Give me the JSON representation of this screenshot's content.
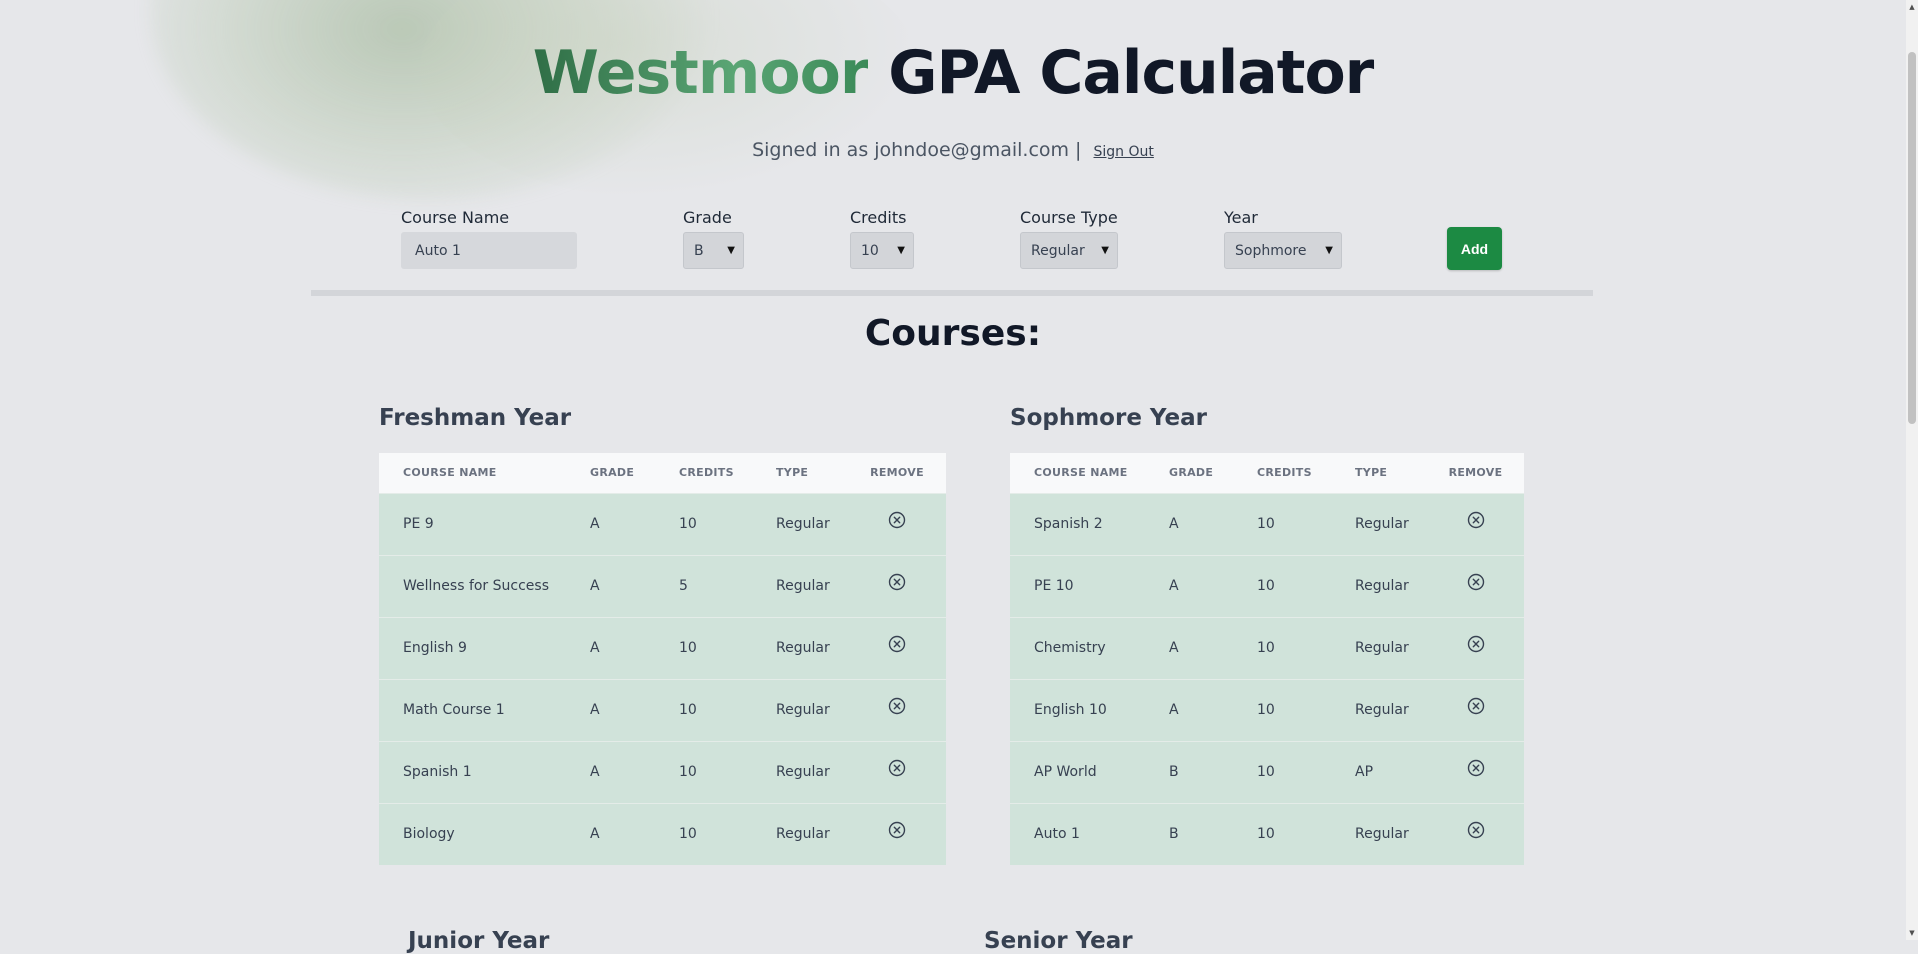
{
  "header": {
    "brand": "Westmoor",
    "title_rest": " GPA Calculator",
    "signed_in_text": "Signed in as johndoe@gmail.com |",
    "sign_out": "Sign Out"
  },
  "form": {
    "course_name_label": "Course Name",
    "course_name_value": "Auto 1",
    "grade_label": "Grade",
    "grade_value": "B",
    "credits_label": "Credits",
    "credits_value": "10",
    "type_label": "Course Type",
    "type_value": "Regular",
    "year_label": "Year",
    "year_value": "Sophmore",
    "add_label": "Add"
  },
  "courses_heading": "Courses:",
  "columns": [
    "COURSE NAME",
    "GRADE",
    "CREDITS",
    "TYPE",
    "REMOVE"
  ],
  "freshman": {
    "title": "Freshman Year",
    "rows": [
      {
        "name": "PE 9",
        "grade": "A",
        "credits": "10",
        "type": "Regular"
      },
      {
        "name": "Wellness for Success",
        "grade": "A",
        "credits": "5",
        "type": "Regular"
      },
      {
        "name": "English 9",
        "grade": "A",
        "credits": "10",
        "type": "Regular"
      },
      {
        "name": "Math Course 1",
        "grade": "A",
        "credits": "10",
        "type": "Regular"
      },
      {
        "name": "Spanish 1",
        "grade": "A",
        "credits": "10",
        "type": "Regular"
      },
      {
        "name": "Biology",
        "grade": "A",
        "credits": "10",
        "type": "Regular"
      }
    ]
  },
  "sophomore": {
    "title": "Sophmore Year",
    "rows": [
      {
        "name": "Spanish 2",
        "grade": "A",
        "credits": "10",
        "type": "Regular"
      },
      {
        "name": "PE 10",
        "grade": "A",
        "credits": "10",
        "type": "Regular"
      },
      {
        "name": "Chemistry",
        "grade": "A",
        "credits": "10",
        "type": "Regular"
      },
      {
        "name": "English 10",
        "grade": "A",
        "credits": "10",
        "type": "Regular"
      },
      {
        "name": "AP World",
        "grade": "B",
        "credits": "10",
        "type": "AP"
      },
      {
        "name": "Auto 1",
        "grade": "B",
        "credits": "10",
        "type": "Regular"
      }
    ]
  },
  "partial_headings": {
    "junior": "Junior Year",
    "senior": "Senior Year"
  },
  "colors": {
    "brand_green": "#3b8a58",
    "add_button": "#1c8a43",
    "row_background": "#d0e3da"
  }
}
